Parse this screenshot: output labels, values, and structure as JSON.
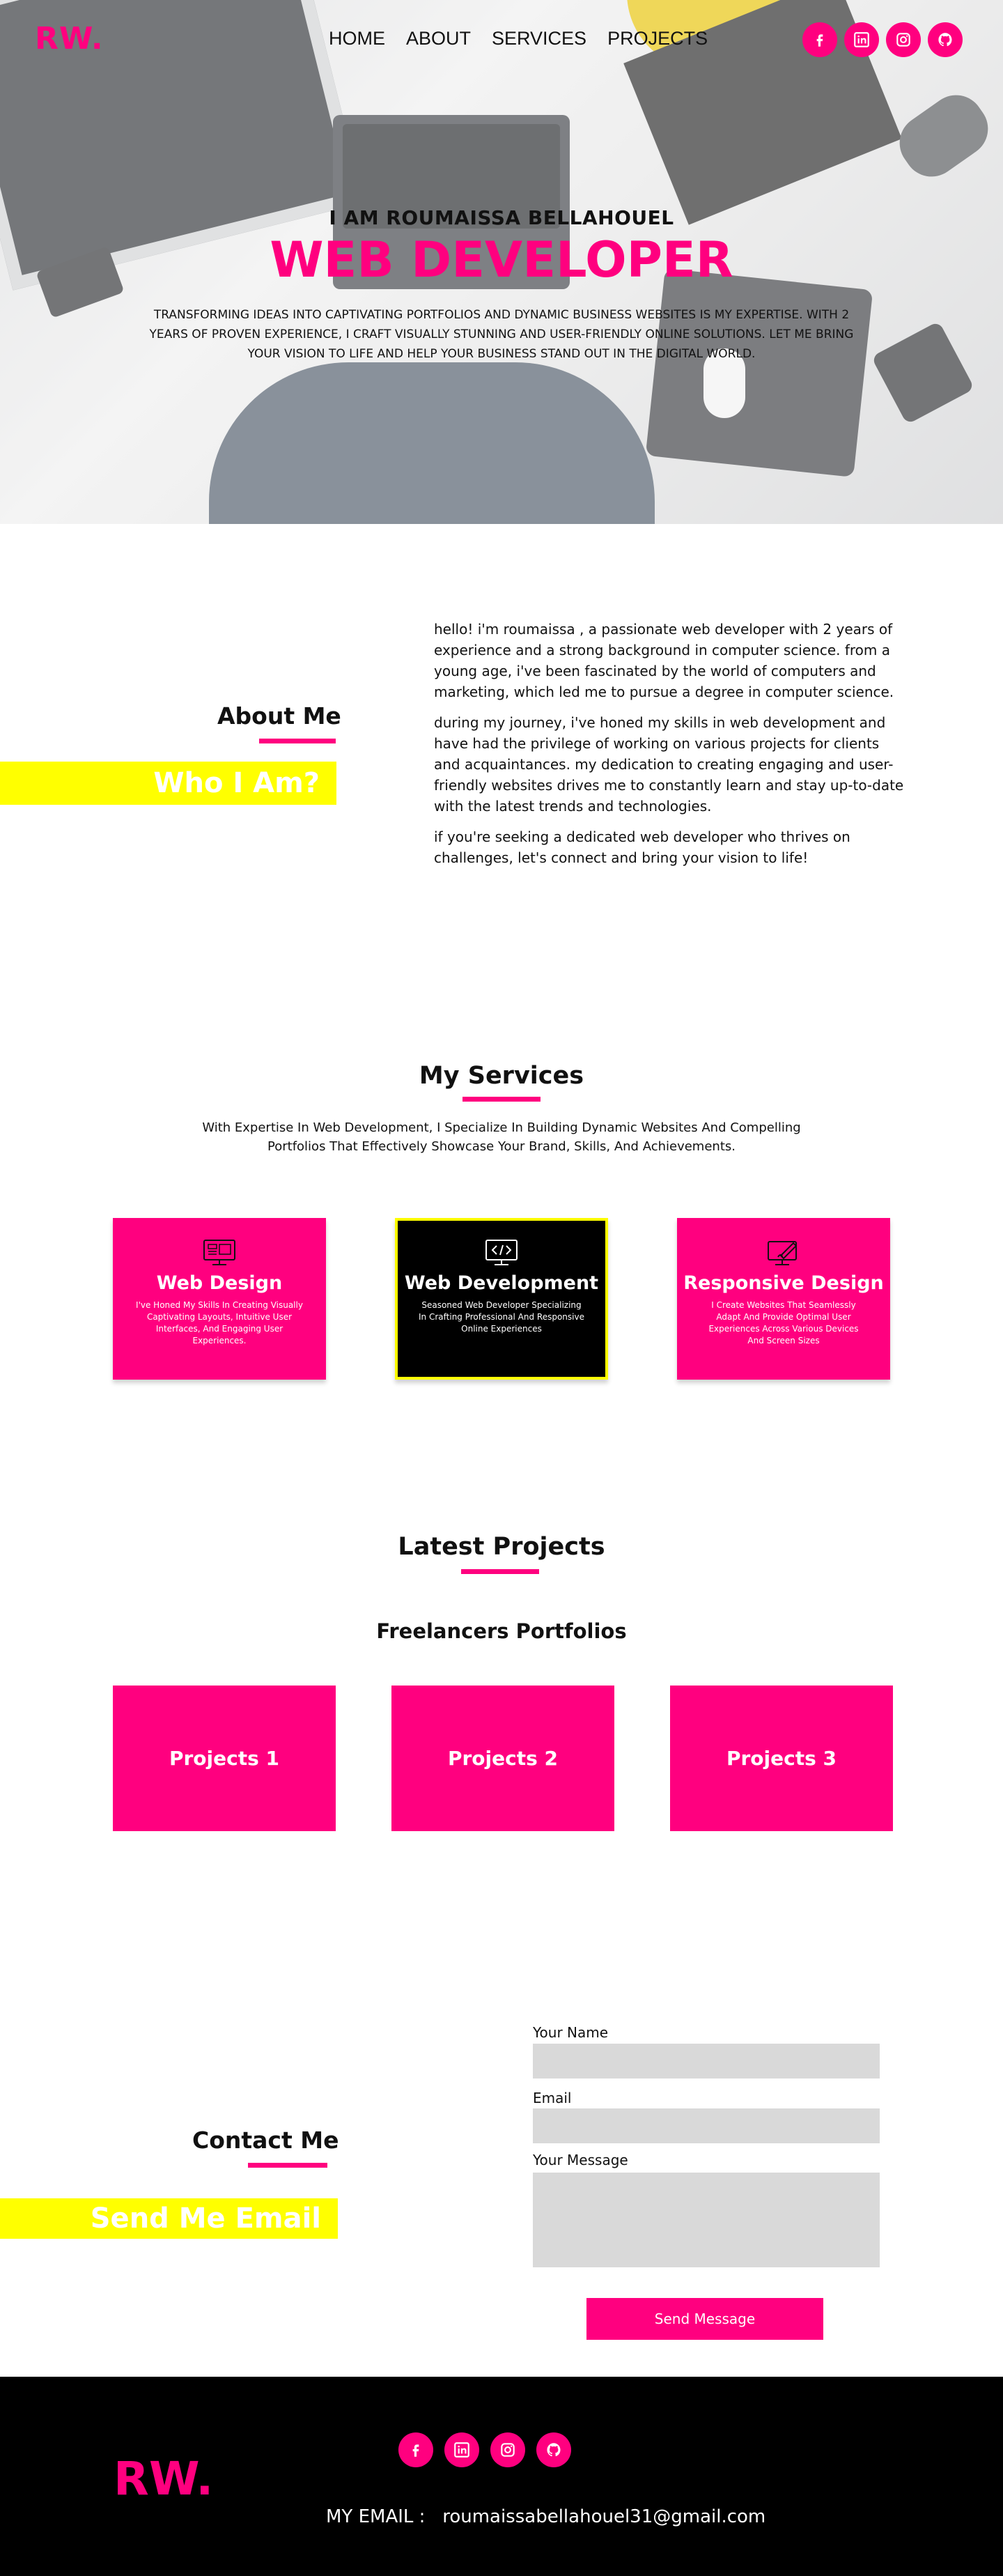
{
  "brand": {
    "logo": "RW.",
    "accent": "#ff007f",
    "highlight": "#ffff00"
  },
  "nav": {
    "items": [
      "HOME",
      "ABOUT",
      "SERVICES",
      "PROJECTS"
    ]
  },
  "social": [
    "facebook-icon",
    "linkedin-icon",
    "instagram-icon",
    "github-icon"
  ],
  "hero": {
    "subtitle": "I AM ROUMAISSA BELLAHOUEL",
    "title": "WEB DEVELOPER",
    "description": "Transforming ideas into captivating portfolios and dynamic business websites is my expertise. With 2 years of proven experience, I craft visually stunning and user-friendly online solutions. Let me bring your vision to life and help your business stand out in the digital world."
  },
  "about": {
    "heading": "About Me",
    "tag": "Who I Am?",
    "paragraphs": [
      "hello! i'm roumaissa , a passionate web developer with 2 years of experience and a strong background in computer science. from a young age, i've been fascinated by the world of computers and marketing, which led me to pursue a degree in computer science.",
      "during my journey, i've honed my skills in web development and have had the privilege of working on various projects for clients and acquaintances. my dedication to creating engaging and user-friendly websites drives me to constantly learn and stay up-to-date with the latest trends and technologies.",
      "if you're seeking a dedicated web developer who thrives on challenges, let's connect and bring your vision to life!"
    ]
  },
  "services": {
    "heading": "My Services",
    "description": "With Expertise In Web Development, I Specialize In Building Dynamic Websites And Compelling Portfolios That Effectively Showcase Your Brand, Skills, And Achievements.",
    "cards": [
      {
        "icon": "web-design-icon",
        "title": "Web Design",
        "text": "I've Honed My Skills In Creating Visually Captivating Layouts, Intuitive User Interfaces, And Engaging User Experiences."
      },
      {
        "icon": "code-icon",
        "title": "Web Development",
        "text": "Seasoned Web Developer Specializing In Crafting Professional And Responsive Online Experiences"
      },
      {
        "icon": "responsive-design-icon",
        "title": "Responsive Design",
        "text": "I Create Websites That Seamlessly Adapt And Provide Optimal User Experiences Across Various Devices And Screen Sizes"
      }
    ]
  },
  "projects": {
    "heading": "Latest Projects",
    "subheading": "Freelancers Portfolios",
    "items": [
      "Projects 1",
      "Projects 2",
      "Projects 3"
    ]
  },
  "contact": {
    "heading": "Contact Me",
    "tag": "Send Me Email",
    "name_label": "Your Name",
    "email_label": "Email",
    "message_label": "Your Message",
    "name_value": "",
    "email_value": "",
    "message_value": "",
    "button": "Send Message"
  },
  "footer": {
    "logo": "RW.",
    "email": "MY EMAIL :   roumaissabellahouel31@gmail.com"
  }
}
